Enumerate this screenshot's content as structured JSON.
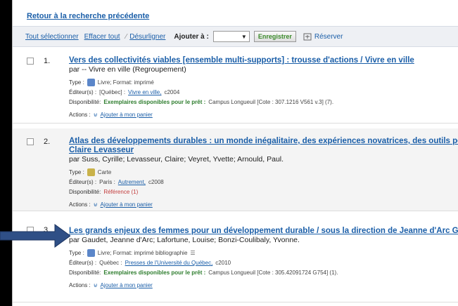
{
  "back_link": "Retour à la recherche précédente",
  "toolbar": {
    "select_all": "Tout sélectionner",
    "clear_all": "Effacer tout",
    "unhighlight": "Désurligner",
    "add_to": "Ajouter à :",
    "save": "Enregistrer",
    "reserve": "Réserver"
  },
  "results": [
    {
      "num": "1.",
      "title": "Vers des collectivités viables [ensemble multi-supports] : trousse d'actions / Vivre en ville",
      "title2": "",
      "author": "par -- Vivre en ville (Regroupement)",
      "type_label": "Type :",
      "type": "Livre; Format: imprimé",
      "publisher_label": "Éditeur(s) :",
      "publisher_pre": "[Québec] :",
      "publisher_link": "Vivre en ville,",
      "publisher_post": "c2004",
      "avail_label": "Disponibilité:",
      "avail_status": "Exemplaires disponibles pour le prêt :",
      "avail_detail": "Campus Longueuil [Cote : 307.1216 V561 v.3] (7).",
      "actions_label": "Actions :",
      "action": "Ajouter à mon panier"
    },
    {
      "num": "2.",
      "title": "Atlas des développements durables : un monde inégalitaire, des expériences novatrices, des outils pour l'ave",
      "title2": "Claire Levasseur",
      "author": "par Suss, Cyrille; Levasseur, Claire; Veyret, Yvette; Arnould, Paul.",
      "type_label": "Type :",
      "type": "Carte",
      "publisher_label": "Éditeur(s) :",
      "publisher_pre": "Paris :",
      "publisher_link": "Autrement,",
      "publisher_post": "c2008",
      "avail_label": "Disponibilité:",
      "avail_status": "Référence (1)",
      "avail_detail": "",
      "actions_label": "Actions :",
      "action": "Ajouter à mon panier"
    },
    {
      "num": "3.",
      "title": "Les grands enjeux des femmes pour un développement durable / sous la direction de Jeanne d'Arc Gaudet e",
      "title2": "",
      "author": "par Gaudet, Jeanne d'Arc; Lafortune, Louise; Bonzi-Coulibaly, Yvonne.",
      "type_label": "Type :",
      "type": "Livre; Format: imprimé bibliographie",
      "publisher_label": "Éditeur(s) :",
      "publisher_pre": "Québec :",
      "publisher_link": "Presses de l'Université du Québec,",
      "publisher_post": "c2010",
      "avail_label": "Disponibilité:",
      "avail_status": "Exemplaires disponibles pour le prêt :",
      "avail_detail": "Campus Longueuil [Cote : 305.42091724 G754] (1).",
      "actions_label": "Actions :",
      "action": "Ajouter à mon panier"
    }
  ],
  "colors": {
    "link": "#1a5ea8",
    "available": "#2e7d2e",
    "reference": "#c23b3b",
    "arrow": "#2f4f86"
  }
}
